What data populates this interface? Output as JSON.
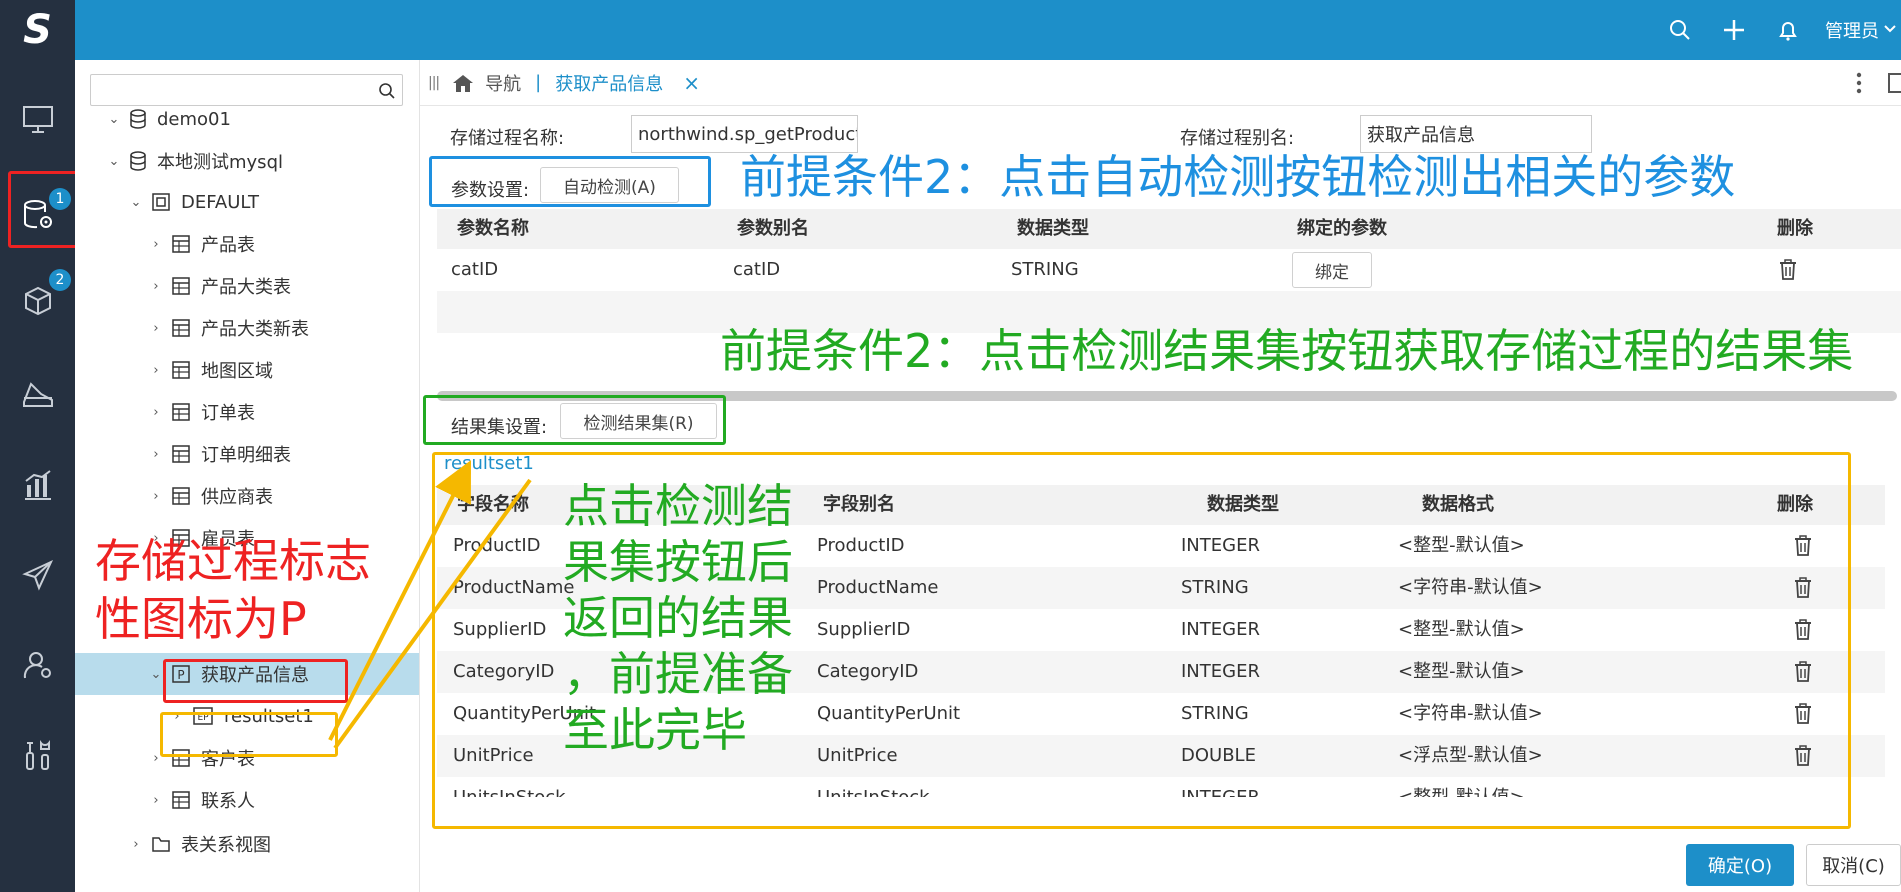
{
  "topbar": {
    "logo": "S",
    "user": "管理员",
    "icons": [
      "search-icon",
      "plus-icon",
      "bell-icon",
      "chevron-down-icon"
    ]
  },
  "rail": {
    "items": [
      "monitor-icon",
      "data-settings-icon",
      "cube-icon",
      "layers-icon",
      "bar-chart-icon",
      "send-icon",
      "user-gear-icon",
      "tools-icon"
    ],
    "badge1": "1",
    "badge2": "2"
  },
  "tree": {
    "search_placeholder": "",
    "rows": [
      {
        "label": "demo01"
      },
      {
        "label": "本地测试mysql"
      },
      {
        "label": "DEFAULT"
      },
      {
        "label": "产品表"
      },
      {
        "label": "产品大类表"
      },
      {
        "label": "产品大类新表"
      },
      {
        "label": "地图区域"
      },
      {
        "label": "订单表"
      },
      {
        "label": "订单明细表"
      },
      {
        "label": "供应商表"
      },
      {
        "label": "雇员表"
      },
      {
        "label": "获取产品信息"
      },
      {
        "label": "resultset1"
      },
      {
        "label": "客户表"
      },
      {
        "label": "联系人"
      },
      {
        "label": "表关系视图"
      }
    ]
  },
  "tabs": {
    "nav": "导航",
    "active": "获取产品信息"
  },
  "form": {
    "proc_name_label": "存储过程名称:",
    "proc_name_value": "northwind.sp_getProductInf",
    "proc_alias_label": "存储过程别名:",
    "proc_alias_value": "获取产品信息",
    "param_label": "参数设置:",
    "auto_detect": "自动检测(A)",
    "result_label": "结果集设置:",
    "detect_result": "检测结果集(R)",
    "resultset_link": "resultset1"
  },
  "params": {
    "headers": [
      "参数名称",
      "参数别名",
      "数据类型",
      "绑定的参数",
      "删除"
    ],
    "rows": [
      {
        "name": "catID",
        "alias": "catID",
        "type": "STRING",
        "bind": "绑定"
      }
    ]
  },
  "fields": {
    "headers": [
      "字段名称",
      "字段别名",
      "数据类型",
      "数据格式",
      "删除"
    ],
    "rows": [
      {
        "name": "ProductID",
        "alias": "ProductID",
        "type": "INTEGER",
        "format": "<整型-默认值>"
      },
      {
        "name": "ProductName",
        "alias": "ProductName",
        "type": "STRING",
        "format": "<字符串-默认值>"
      },
      {
        "name": "SupplierID",
        "alias": "SupplierID",
        "type": "INTEGER",
        "format": "<整型-默认值>"
      },
      {
        "name": "CategoryID",
        "alias": "CategoryID",
        "type": "INTEGER",
        "format": "<整型-默认值>"
      },
      {
        "name": "QuantityPerUnit",
        "alias": "QuantityPerUnit",
        "type": "STRING",
        "format": "<字符串-默认值>"
      },
      {
        "name": "UnitPrice",
        "alias": "UnitPrice",
        "type": "DOUBLE",
        "format": "<浮点型-默认值>"
      },
      {
        "name": "UnitsInStock",
        "alias": "UnitsInStock",
        "type": "INTEGER",
        "format": "<整型-默认值>"
      }
    ]
  },
  "annotations": {
    "a1": "前提条件2：点击自动检测按钮检测出相关的参数",
    "a2": "前提条件2：点击检测结果集按钮获取存储过程的结果集",
    "a3_l1": "存储过程标志",
    "a3_l2": "性图标为P",
    "a4_l1": "点击检测结",
    "a4_l2": "果集按钮后",
    "a4_l3": "返回的结果",
    "a4_l4": "，前提准备",
    "a4_l5": "至此完毕"
  },
  "footer": {
    "ok": "确定(O)",
    "cancel": "取消(C)"
  },
  "colors": {
    "brand": "#1d8fc9",
    "rail": "#253040",
    "annot_blue": "#1e90e0",
    "annot_green": "#22aa22",
    "annot_red": "#ee2222",
    "annot_yellow": "#f5b800"
  }
}
